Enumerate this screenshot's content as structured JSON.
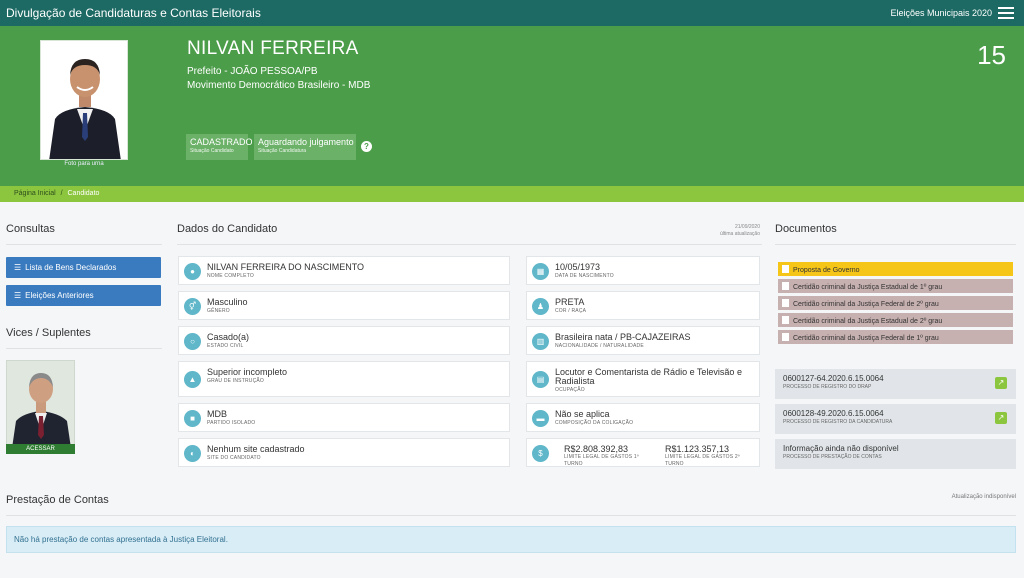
{
  "app": {
    "title": "Divulgação de Candidaturas e Contas Eleitorais",
    "election": "Eleições Municipais 2020"
  },
  "candidate": {
    "name": "NILVAN FERREIRA",
    "office": "Prefeito - JOÃO PESSOA/PB",
    "party": "Movimento Democrático Brasileiro - MDB",
    "number": "15",
    "photo_caption": "Foto para urna",
    "status1": {
      "value": "CADASTRADO",
      "label": "Situação Candidato"
    },
    "status2": {
      "value": "Aguardando julgamento",
      "label": "Situação Candidatura"
    }
  },
  "breadcrumb": {
    "home": "Página Inicial",
    "sep": "/",
    "current": "Candidato"
  },
  "sidebar": {
    "title": "Consultas",
    "btn1": "Lista de Bens Declarados",
    "btn2": "Eleições Anteriores",
    "vices_title": "Vices / Suplentes",
    "vice_button": "ACESSAR"
  },
  "dados": {
    "title": "Dados do Candidato",
    "update_date": "21/09/2020",
    "update_label": "última atualização",
    "fields": {
      "nome": {
        "value": "NILVAN FERREIRA DO NASCIMENTO",
        "label": "NOME COMPLETO"
      },
      "nascimento": {
        "value": "10/05/1973",
        "label": "DATA DE NASCIMENTO"
      },
      "genero": {
        "value": "Masculino",
        "label": "GÊNERO"
      },
      "cor": {
        "value": "PRETA",
        "label": "COR / RAÇA"
      },
      "civil": {
        "value": "Casado(a)",
        "label": "ESTADO CIVIL"
      },
      "nacionalidade": {
        "value": "Brasileira nata / PB-CAJAZEIRAS",
        "label": "NACIONALIDADE / NATURALIDADE"
      },
      "instrucao": {
        "value": "Superior incompleto",
        "label": "GRAU DE INSTRUÇÃO"
      },
      "ocupacao": {
        "value1": "Locutor e Comentarista de Rádio e Televisão e",
        "value2": "Radialista",
        "label": "OCUPAÇÃO"
      },
      "partido": {
        "value": "MDB",
        "label": "PARTIDO ISOLADO"
      },
      "coligacao": {
        "value": "Não se aplica",
        "label": "COMPOSIÇÃO DA COLIGAÇÃO"
      },
      "site": {
        "value": "Nenhum site cadastrado",
        "label": "SITE DO CANDIDATO"
      },
      "gastos1": {
        "value": "R$2.808.392,83",
        "label1": "LIMITE LEGAL DE GASTOS 1º",
        "label2": "TURNO"
      },
      "gastos2": {
        "value": "R$1.123.357,13",
        "label1": "LIMITE LEGAL DE GASTOS 2º",
        "label2": "TURNO"
      }
    }
  },
  "documentos": {
    "title": "Documentos",
    "items": [
      "Proposta de Governo",
      "Certidão criminal da Justiça Estadual de 1º grau",
      "Certidão criminal da Justiça Federal de 2º grau",
      "Certidão criminal da Justiça Estadual de 2º grau",
      "Certidão criminal da Justiça Federal de 1º grau"
    ],
    "proc1": {
      "value": "0600127-64.2020.6.15.0064",
      "label": "PROCESSO DE REGISTRO DO DRAP"
    },
    "proc2": {
      "value": "0600128-49.2020.6.15.0064",
      "label": "PROCESSO DE REGISTRO DA CANDIDATURA"
    },
    "proc3": {
      "value": "Informação ainda não disponível",
      "label": "PROCESSO DE PRESTAÇÃO DE CONTAS"
    }
  },
  "prestacao": {
    "title": "Prestação de Contas",
    "update": "Atualização indisponível",
    "message": "Não há prestação de contas apresentada à Justiça Eleitoral."
  },
  "colors": {
    "topbar": "#1d6a64",
    "hero": "#4c9d4a",
    "breadcrumb": "#8cc63f",
    "button": "#3a7bbf",
    "icon": "#5fb7c9"
  }
}
